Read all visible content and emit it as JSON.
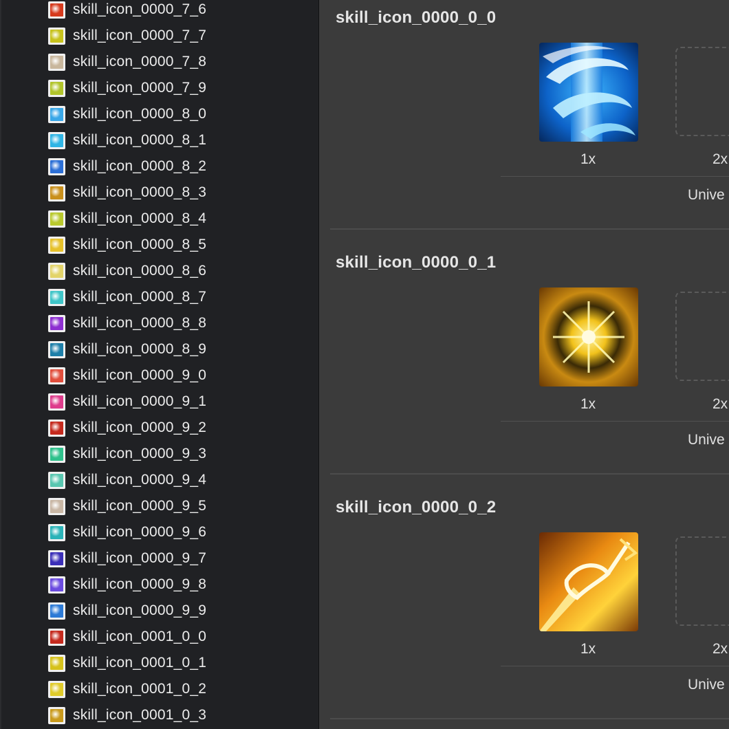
{
  "sidebar": {
    "items": [
      {
        "label": "skill_icon_0000_7_6",
        "color": "#d63a1d"
      },
      {
        "label": "skill_icon_0000_7_7",
        "color": "#c7c21c"
      },
      {
        "label": "skill_icon_0000_7_8",
        "color": "#c9b79d"
      },
      {
        "label": "skill_icon_0000_7_9",
        "color": "#b1c42a"
      },
      {
        "label": "skill_icon_0000_8_0",
        "color": "#39a7e8"
      },
      {
        "label": "skill_icon_0000_8_1",
        "color": "#2fb5e5"
      },
      {
        "label": "skill_icon_0000_8_2",
        "color": "#2c6fd6"
      },
      {
        "label": "skill_icon_0000_8_3",
        "color": "#c9901c"
      },
      {
        "label": "skill_icon_0000_8_4",
        "color": "#b9c92d"
      },
      {
        "label": "skill_icon_0000_8_5",
        "color": "#e6c12a"
      },
      {
        "label": "skill_icon_0000_8_6",
        "color": "#e3d46a"
      },
      {
        "label": "skill_icon_0000_8_7",
        "color": "#3fc5c8"
      },
      {
        "label": "skill_icon_0000_8_8",
        "color": "#8d2fd1"
      },
      {
        "label": "skill_icon_0000_8_9",
        "color": "#1d7fa9"
      },
      {
        "label": "skill_icon_0000_9_0",
        "color": "#e14e3c"
      },
      {
        "label": "skill_icon_0000_9_1",
        "color": "#de3c8c"
      },
      {
        "label": "skill_icon_0000_9_2",
        "color": "#c52a1e"
      },
      {
        "label": "skill_icon_0000_9_3",
        "color": "#2fc18c"
      },
      {
        "label": "skill_icon_0000_9_4",
        "color": "#58c7b0"
      },
      {
        "label": "skill_icon_0000_9_5",
        "color": "#c9b7a5"
      },
      {
        "label": "skill_icon_0000_9_6",
        "color": "#2ab3b8"
      },
      {
        "label": "skill_icon_0000_9_7",
        "color": "#3b2fb8"
      },
      {
        "label": "skill_icon_0000_9_8",
        "color": "#6b4be0"
      },
      {
        "label": "skill_icon_0000_9_9",
        "color": "#2c7ad6"
      },
      {
        "label": "skill_icon_0001_0_0",
        "color": "#c52a1e"
      },
      {
        "label": "skill_icon_0001_0_1",
        "color": "#d6c21c"
      },
      {
        "label": "skill_icon_0001_0_2",
        "color": "#e0cb2a"
      },
      {
        "label": "skill_icon_0001_0_3",
        "color": "#c99a1c"
      }
    ]
  },
  "main": {
    "sections": [
      {
        "title": "skill_icon_0000_0_0",
        "scale_1x": "1x",
        "scale_2x": "2x",
        "device": "Unive",
        "icon": "blue-swirl"
      },
      {
        "title": "skill_icon_0000_0_1",
        "scale_1x": "1x",
        "scale_2x": "2x",
        "device": "Unive",
        "icon": "golden-burst"
      },
      {
        "title": "skill_icon_0000_0_2",
        "scale_1x": "1x",
        "scale_2x": "2x",
        "device": "Unive",
        "icon": "fire-staff"
      }
    ]
  }
}
